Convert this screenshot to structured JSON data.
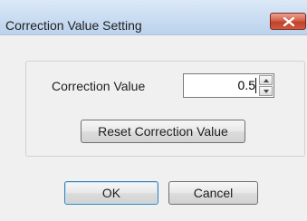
{
  "window": {
    "title": "Correction Value Setting",
    "close_icon": "close-icon"
  },
  "correction": {
    "label": "Correction Value",
    "value": "0.5",
    "spinner_up_icon": "chevron-up-icon",
    "spinner_down_icon": "chevron-down-icon"
  },
  "buttons": {
    "reset_label": "Reset Correction Value",
    "ok_label": "OK",
    "cancel_label": "Cancel"
  }
}
